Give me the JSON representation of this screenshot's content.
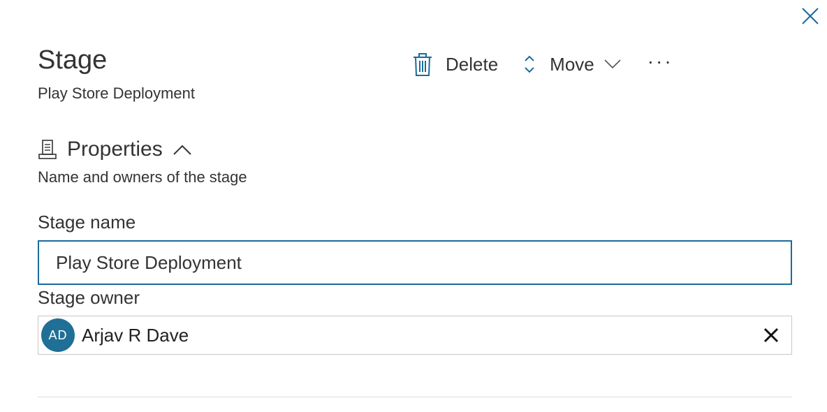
{
  "panel": {
    "title": "Stage",
    "subtitle": "Play Store Deployment",
    "close_icon": "close-icon"
  },
  "toolbar": {
    "delete_label": "Delete",
    "delete_icon": "trash-icon",
    "move_label": "Move",
    "move_icon": "up-down-chevron-icon",
    "move_dropdown_icon": "chevron-down-icon",
    "more_label": "···",
    "accent_color": "#1b6a9c"
  },
  "properties": {
    "title": "Properties",
    "icon": "properties-icon",
    "collapse_icon": "chevron-up-icon",
    "description": "Name and owners of the stage"
  },
  "stage_name": {
    "label": "Stage name",
    "value": "Play Store Deployment"
  },
  "stage_owner": {
    "label": "Stage owner",
    "avatar_initials": "AD",
    "avatar_color": "#1f6f96",
    "name": "Arjav R Dave",
    "remove_icon": "close-icon"
  }
}
